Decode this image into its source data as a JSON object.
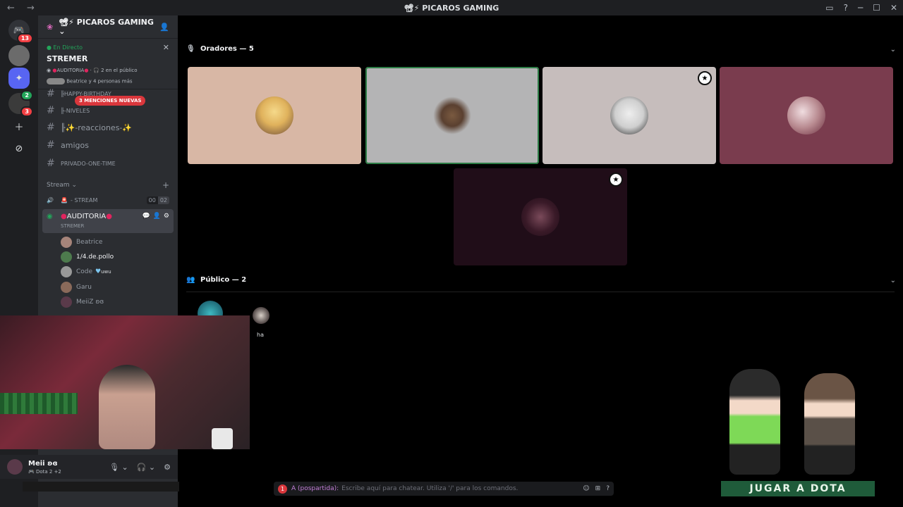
{
  "titlebar": {
    "title": "PICAROS GAMING",
    "server_emojis": "📽⚡",
    "back": "←",
    "forward": "→"
  },
  "rail": {
    "dm_badge": "13",
    "server_badge_top": "2",
    "server_badge_bottom": "3"
  },
  "server": {
    "name": "PICAROS GAMING",
    "emojis": "📽⚡"
  },
  "live": {
    "label": "En Directo",
    "title": "STREMER",
    "channel": "AUDITORIA",
    "audience": "2 en el público",
    "people": "Beatrice y 4 personas más"
  },
  "channels": [
    {
      "name": "╟HAPPY-BIRTHDAY"
    },
    {
      "name": "╟-NIVELES"
    },
    {
      "name": "╟✨-reacciones-✨"
    },
    {
      "name": "amigos"
    },
    {
      "name": "PRIVADO-ONE-TIME"
    }
  ],
  "mentions_badge": "3 MENCIONES NUEVAS",
  "category": {
    "name": "Stream"
  },
  "voice": [
    {
      "name": "- STREAM",
      "count_a": "00",
      "count_b": "02"
    },
    {
      "name": "AUDITORIA",
      "sub": "STREMER"
    }
  ],
  "members": [
    {
      "name": "Beatrice",
      "extra": ""
    },
    {
      "name": "1/4.de.pollo",
      "extra": ""
    },
    {
      "name": "Code",
      "extra": "uwu"
    },
    {
      "name": "Garu",
      "extra": ""
    },
    {
      "name": "MeiiZ ʚɞ",
      "extra": ""
    }
  ],
  "stage": {
    "speakers_title": "Oradores — 5",
    "audience_title": "Público — 2",
    "audience_member": "ha"
  },
  "colors": {
    "tile1": "#d8b7a5",
    "tile2": "#b4b4b5",
    "tile3": "#c6bdbc",
    "tile4": "#7a3c4e",
    "tile5": "#200d18",
    "accent_green": "#23a55a",
    "speaking_border": "#2d7d46"
  },
  "user": {
    "name": "Meii ʚɞ",
    "status": "Dota 2 +2"
  },
  "chat": {
    "mention": "1",
    "who": "A (pospartida):",
    "placeholder": "Escribe aquí para chatear. Utiliza '/' para los comandos."
  },
  "overlay": {
    "button": "JUGAR A DOTA"
  },
  "icons": [
    "mic-icon",
    "headphones-icon",
    "gear-icon",
    "plus-icon",
    "compass-icon",
    "hash-icon",
    "speaker-icon",
    "users-icon",
    "chevron-down-icon"
  ]
}
